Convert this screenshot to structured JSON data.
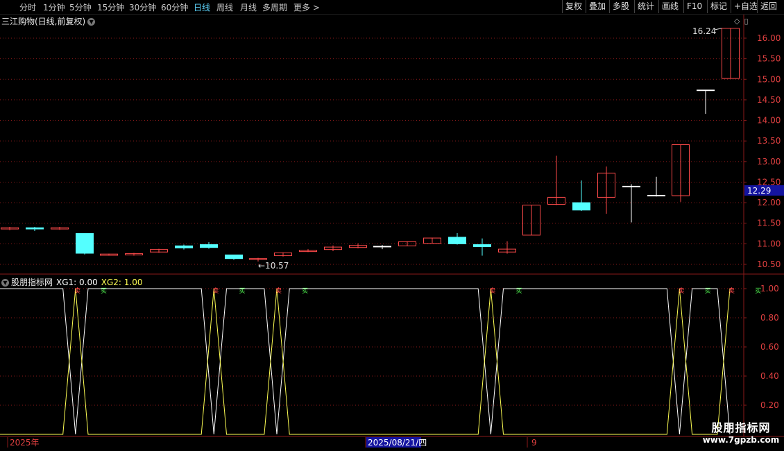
{
  "toolbar": {
    "periods": [
      "分时",
      "1分钟",
      "5分钟",
      "15分钟",
      "30分钟",
      "60分钟",
      "日线",
      "周线",
      "月线",
      "多周期",
      "更多 >"
    ],
    "active_period": "日线",
    "buttons": [
      "复权",
      "叠加",
      "多股",
      "统计",
      "画线",
      "F10",
      "标记",
      "+自选",
      "返回"
    ]
  },
  "stock": {
    "title": "三江购物(日线,前复权)"
  },
  "indicator": {
    "name": "股朋指标网",
    "xg1_label": "XG1: 0.00",
    "xg2_label": "XG2: 1.00"
  },
  "time_axis": {
    "start_label": "2025年",
    "cursor_label": "2025/08/21/四",
    "mid_label": "9"
  },
  "watermark": {
    "line1": "股朋指标网",
    "line2": "www.7gpzb.com"
  },
  "colors": {
    "up": "#ff4a4a",
    "down": "#54ffff",
    "doji": "#ffffff",
    "xg1": "#ffffff",
    "xg2": "#ffff54",
    "grid": "#8b1a1a",
    "current_price_bg": "#1414a0"
  },
  "chart_data": [
    {
      "type": "candlestick",
      "title": "三江购物(日线,前复权)",
      "ylim": [
        10.3,
        16.5
      ],
      "y_ticks": [
        "16.00",
        "15.50",
        "15.00",
        "14.50",
        "14.00",
        "13.50",
        "13.00",
        "12.50",
        "12.00",
        "11.50",
        "11.00",
        "10.50"
      ],
      "current_price": "12.29",
      "annotations": {
        "high": "16.24",
        "low": "10.57"
      },
      "candles": [
        {
          "o": 11.36,
          "c": 11.39,
          "h": 11.41,
          "l": 11.33
        },
        {
          "o": 11.39,
          "c": 11.36,
          "h": 11.41,
          "l": 11.31
        },
        {
          "o": 11.36,
          "c": 11.39,
          "h": 11.41,
          "l": 11.34
        },
        {
          "o": 11.25,
          "c": 10.77,
          "h": 11.25,
          "l": 10.74
        },
        {
          "o": 10.72,
          "c": 10.75,
          "h": 10.76,
          "l": 10.71
        },
        {
          "o": 10.73,
          "c": 10.76,
          "h": 10.78,
          "l": 10.71
        },
        {
          "o": 10.8,
          "c": 10.86,
          "h": 10.88,
          "l": 10.78
        },
        {
          "o": 10.95,
          "c": 10.9,
          "h": 10.98,
          "l": 10.86
        },
        {
          "o": 10.98,
          "c": 10.91,
          "h": 11.04,
          "l": 10.88
        },
        {
          "o": 10.73,
          "c": 10.64,
          "h": 10.73,
          "l": 10.61
        },
        {
          "o": 10.62,
          "c": 10.64,
          "h": 10.66,
          "l": 10.57
        },
        {
          "o": 10.71,
          "c": 10.78,
          "h": 10.79,
          "l": 10.69
        },
        {
          "o": 10.81,
          "c": 10.84,
          "h": 10.87,
          "l": 10.8
        },
        {
          "o": 10.86,
          "c": 10.92,
          "h": 10.96,
          "l": 10.82
        },
        {
          "o": 10.91,
          "c": 10.96,
          "h": 11.01,
          "l": 10.89
        },
        {
          "o": 10.94,
          "c": 10.93,
          "h": 10.97,
          "l": 10.87
        },
        {
          "o": 10.95,
          "c": 11.05,
          "h": 11.06,
          "l": 10.94
        },
        {
          "o": 11.01,
          "c": 11.14,
          "h": 11.15,
          "l": 11.01
        },
        {
          "o": 11.16,
          "c": 11.0,
          "h": 11.26,
          "l": 10.98
        },
        {
          "o": 10.98,
          "c": 10.93,
          "h": 11.13,
          "l": 10.71
        },
        {
          "o": 10.8,
          "c": 10.87,
          "h": 11.06,
          "l": 10.76
        },
        {
          "o": 11.21,
          "c": 11.94,
          "h": 11.94,
          "l": 11.21
        },
        {
          "o": 11.96,
          "c": 12.13,
          "h": 13.14,
          "l": 11.94
        },
        {
          "o": 12.0,
          "c": 11.82,
          "h": 12.54,
          "l": 11.8
        },
        {
          "o": 12.13,
          "c": 12.72,
          "h": 12.88,
          "l": 11.73
        },
        {
          "o": 12.4,
          "c": 12.39,
          "h": 12.45,
          "l": 11.52
        },
        {
          "o": 12.17,
          "c": 12.18,
          "h": 12.63,
          "l": 12.15
        },
        {
          "o": 12.17,
          "c": 13.41,
          "h": 13.41,
          "l": 12.02
        },
        {
          "o": 14.74,
          "c": 14.73,
          "h": 14.74,
          "l": 14.16
        },
        {
          "o": 15.02,
          "c": 16.24,
          "h": 16.24,
          "l": 15.02
        }
      ]
    },
    {
      "type": "line",
      "title": "股朋指标网",
      "ylim": [
        0.0,
        1.05
      ],
      "y_ticks": [
        "1.00",
        "0.80",
        "0.60",
        "0.40",
        "0.20"
      ],
      "series": [
        {
          "name": "XG1",
          "values": [
            1,
            1,
            1,
            1,
            1,
            1,
            0,
            1,
            1,
            1,
            1,
            1,
            1,
            1,
            1,
            1,
            1,
            0,
            1,
            1,
            1,
            1,
            0,
            1,
            1,
            1,
            1,
            1,
            1,
            1,
            1,
            1,
            1,
            1,
            1,
            1,
            1,
            1,
            1,
            0,
            1,
            1,
            1,
            1,
            1,
            1,
            1,
            1,
            1,
            1,
            1,
            1,
            1,
            1,
            0,
            1,
            1,
            1,
            0
          ]
        },
        {
          "name": "XG2",
          "values": [
            0,
            0,
            0,
            0,
            0,
            0,
            1,
            0,
            0,
            0,
            0,
            0,
            0,
            0,
            0,
            0,
            0,
            1,
            0,
            0,
            0,
            0,
            1,
            0,
            0,
            0,
            0,
            0,
            0,
            0,
            0,
            0,
            0,
            0,
            0,
            0,
            0,
            0,
            0,
            1,
            0,
            0,
            0,
            0,
            0,
            0,
            0,
            0,
            0,
            0,
            0,
            0,
            0,
            0,
            1,
            0,
            0,
            0,
            1
          ]
        }
      ],
      "markers": [
        "买",
        "卖"
      ]
    }
  ]
}
